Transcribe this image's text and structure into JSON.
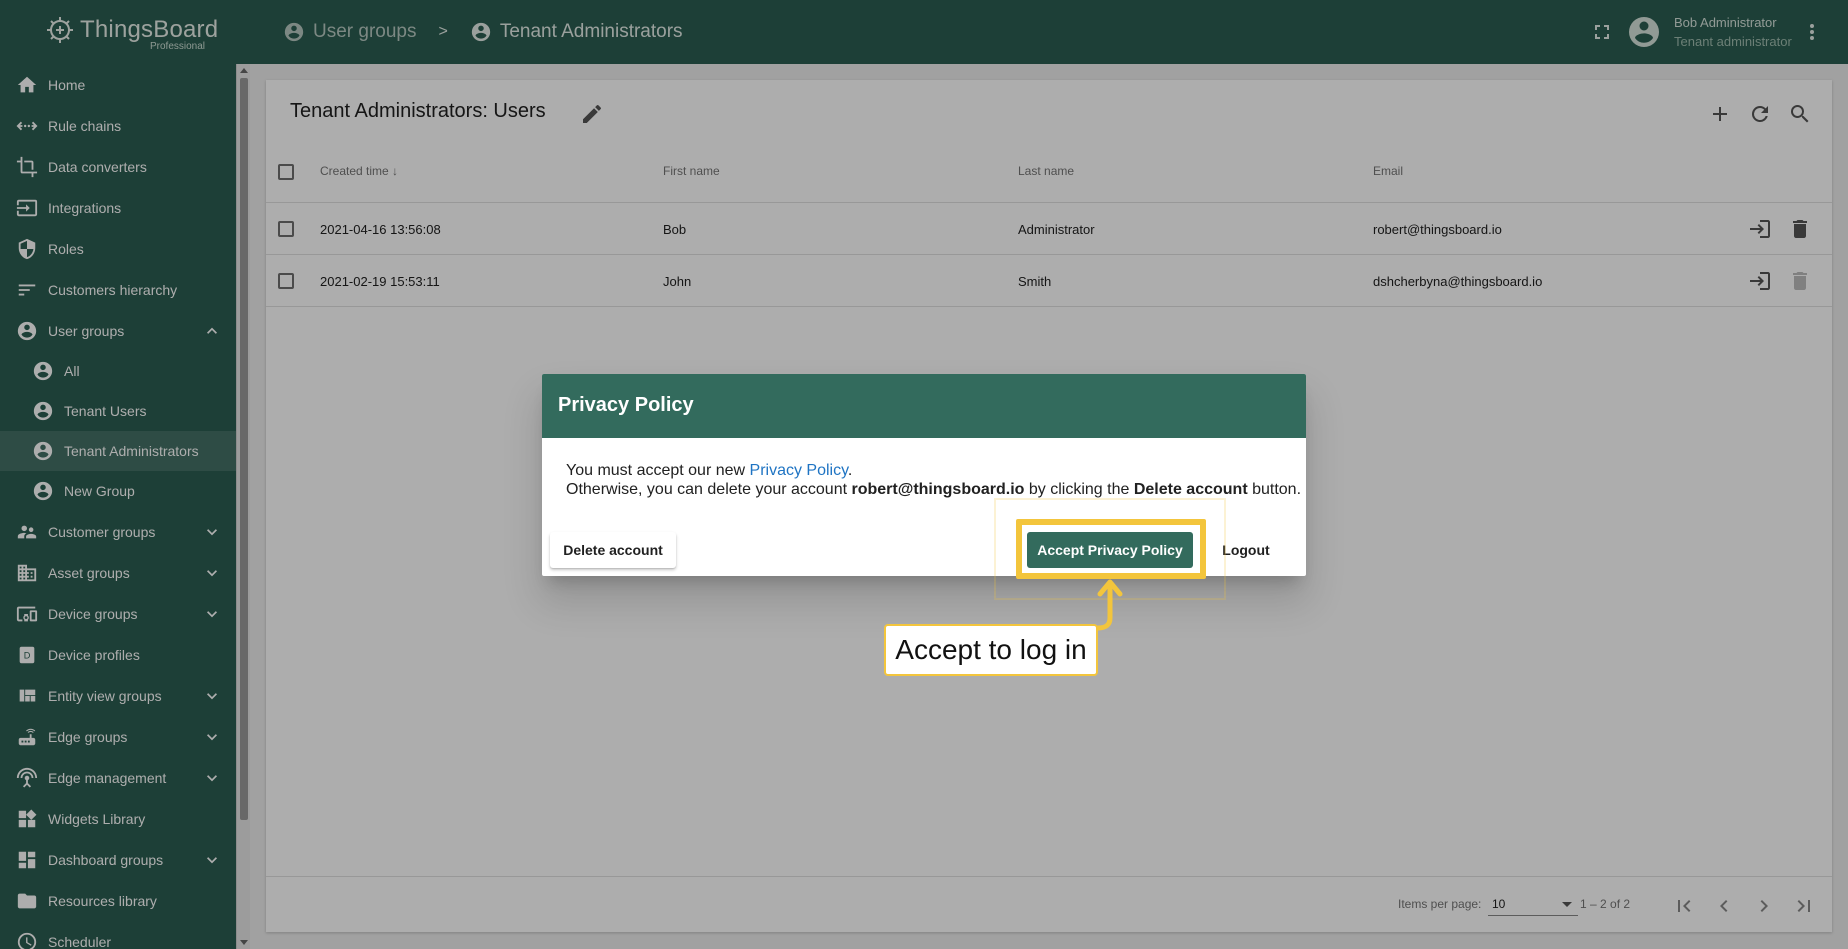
{
  "app": {
    "name": "ThingsBoard",
    "edition": "Professional"
  },
  "breadcrumb": {
    "parent": "User groups",
    "separator": ">",
    "current": "Tenant Administrators"
  },
  "user": {
    "name": "Bob Administrator",
    "role": "Tenant administrator"
  },
  "sidebar": {
    "items": [
      {
        "label": "Home",
        "icon": "home-icon"
      },
      {
        "label": "Rule chains",
        "icon": "rule-chains-icon"
      },
      {
        "label": "Data converters",
        "icon": "crop-icon"
      },
      {
        "label": "Integrations",
        "icon": "input-icon"
      },
      {
        "label": "Roles",
        "icon": "shield-icon"
      },
      {
        "label": "Customers hierarchy",
        "icon": "sort-icon"
      },
      {
        "label": "User groups",
        "icon": "account-circle-icon",
        "expanded": true
      },
      {
        "label": "Customer groups",
        "icon": "supervisor-account-icon"
      },
      {
        "label": "Asset groups",
        "icon": "domain-icon"
      },
      {
        "label": "Device groups",
        "icon": "devices-other-icon"
      },
      {
        "label": "Device profiles",
        "icon": "device-profile-icon"
      },
      {
        "label": "Entity view groups",
        "icon": "view-quilt-icon"
      },
      {
        "label": "Edge groups",
        "icon": "router-icon"
      },
      {
        "label": "Edge management",
        "icon": "settings-input-antenna-icon"
      },
      {
        "label": "Widgets Library",
        "icon": "widgets-icon"
      },
      {
        "label": "Dashboard groups",
        "icon": "dashboard-icon"
      },
      {
        "label": "Resources library",
        "icon": "folder-icon"
      },
      {
        "label": "Scheduler",
        "icon": "schedule-icon"
      }
    ],
    "user_group_children": [
      {
        "label": "All"
      },
      {
        "label": "Tenant Users"
      },
      {
        "label": "Tenant Administrators",
        "active": true
      },
      {
        "label": "New Group"
      }
    ]
  },
  "panel": {
    "title": "Tenant Administrators: Users",
    "columns": [
      "Created time",
      "First name",
      "Last name",
      "Email"
    ],
    "rows": [
      {
        "created": "2021-04-16 13:56:08",
        "first": "Bob",
        "last": "Administrator",
        "email": "robert@thingsboard.io"
      },
      {
        "created": "2021-02-19 15:53:11",
        "first": "John",
        "last": "Smith",
        "email": "dshcherbyna@thingsboard.io"
      }
    ],
    "items_per_page_label": "Items per page:",
    "items_per_page_value": "10",
    "range_label": "1 – 2 of 2"
  },
  "dialog": {
    "title": "Privacy Policy",
    "line1_prefix": "You must accept our new ",
    "line1_link": "Privacy Policy",
    "line1_suffix": ".",
    "line2_prefix": "Otherwise, you can delete your account ",
    "line2_email": "robert@thingsboard.io",
    "line2_middle": " by clicking the ",
    "line2_bold": "Delete account",
    "line2_suffix": " button.",
    "delete_label": "Delete account",
    "accept_label": "Accept Privacy Policy",
    "logout_label": "Logout"
  },
  "annotation": {
    "callout_text": "Accept to log in",
    "color": "#f3c53c"
  },
  "colors": {
    "primary": "#2b5e51",
    "dialog_header": "#336b5d",
    "link": "#1f74c3"
  }
}
